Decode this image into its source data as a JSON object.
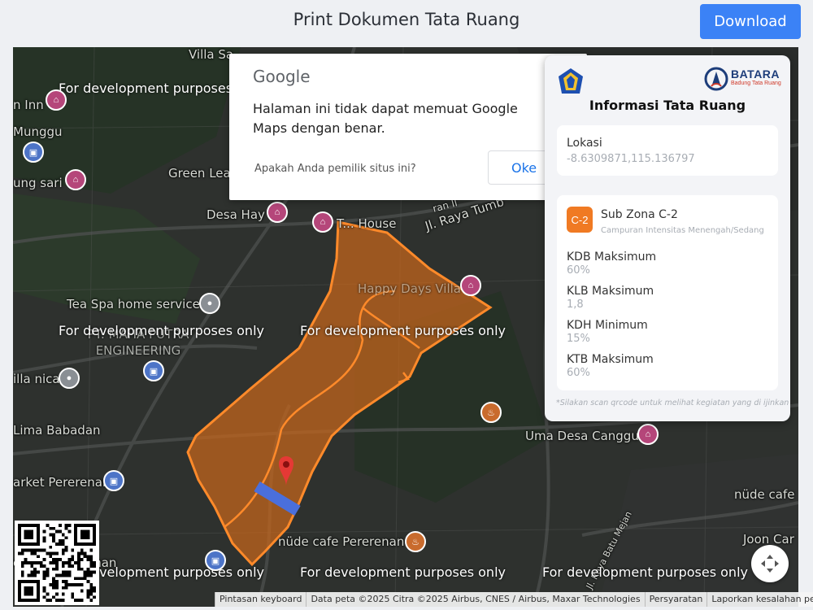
{
  "header": {
    "title": "Print Dokumen Tata Ruang",
    "download_label": "Download"
  },
  "map": {
    "labels": [
      "Villa Sa",
      "n Inn",
      "Munggu",
      "ung sari",
      "Green Lea",
      "Desa Hay",
      "T... House",
      "Jl. Raya Tumb",
      "Happy Days Villa",
      "Tea Spa home service",
      "PT. MAHA PUTRA ENGINEERING",
      "illa nica",
      "Lima Babadan",
      "Uma Desa Canggu",
      "arket Pererenan",
      "nüde cafe",
      "nüde cafe Pererenan",
      "eative Pererenan",
      "Joon Car",
      "Jl. Raya Batu Mejan",
      "ran II"
    ],
    "watermark": "For development purposes only",
    "watermark_short": "For development purposes o",
    "attribution": [
      "Pintasan keyboard",
      "Data peta ©2025 Citra ©2025 Airbus, CNES / Airbus, Maxar Technologies",
      "Persyaratan",
      "Laporkan kesalahan peta"
    ]
  },
  "google_dialog": {
    "logo": "Google",
    "message": "Halaman ini tidak dapat memuat Google Maps dengan benar.",
    "owner_question": "Apakah Anda pemilik situs ini?",
    "ok_label": "Oke"
  },
  "info_panel": {
    "brand_name": "BATARA",
    "brand_sub": "Badung Tata Ruang",
    "title": "Informasi Tata Ruang",
    "lokasi_label": "Lokasi",
    "lokasi_value": "-8.6309871,115.136797",
    "zone_code": "C-2",
    "zone_name": "Sub Zona C-2",
    "zone_desc": "Campuran Intensitas Menengah/Sedang",
    "kdb_label": "KDB Maksimum",
    "kdb_value": "60%",
    "klb_label": "KLB Maksimum",
    "klb_value": "1,8",
    "kdh_label": "KDH Minimum",
    "kdh_value": "15%",
    "ktb_label": "KTB Maksimum",
    "ktb_value": "60%",
    "footnote": "*Silakan scan qrcode untuk melihat kegiatan yang di ijinkan"
  },
  "colors": {
    "accent": "#3b82f6",
    "zone": "#f07a23",
    "parcel_fill": "#c8661c",
    "parcel_stroke": "#ff8a2a"
  }
}
